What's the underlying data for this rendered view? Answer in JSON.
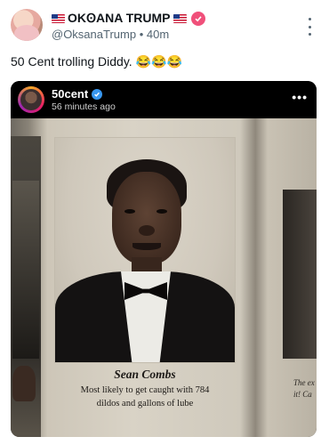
{
  "author": {
    "flag_left": "🇺🇸",
    "display_name": "OKꙨANA TRUMP",
    "flag_right": "🇺🇸",
    "handle": "@OksanaTrump",
    "separator": "•",
    "time": "40m"
  },
  "post": {
    "text": "50 Cent trolling Diddy. 😂😂😂"
  },
  "embed": {
    "username": "50cent",
    "time": "56 minutes ago",
    "more": "•••",
    "caption": {
      "name": "Sean Combs",
      "line1": "Most likely to get caught with 784",
      "line2": "dildos and gallons of lube"
    },
    "right_caption": {
      "line1": "The ex",
      "line2": "it! Ca"
    }
  },
  "colors": {
    "verified_badge": "#f0507a",
    "text_secondary": "#536471",
    "embed_header_bg": "#000000",
    "embed_verified": "#3897f0"
  },
  "icons": {
    "verified": "verified-badge-icon",
    "more": "more-vertical-icon",
    "embed_more": "more-horizontal-icon"
  }
}
